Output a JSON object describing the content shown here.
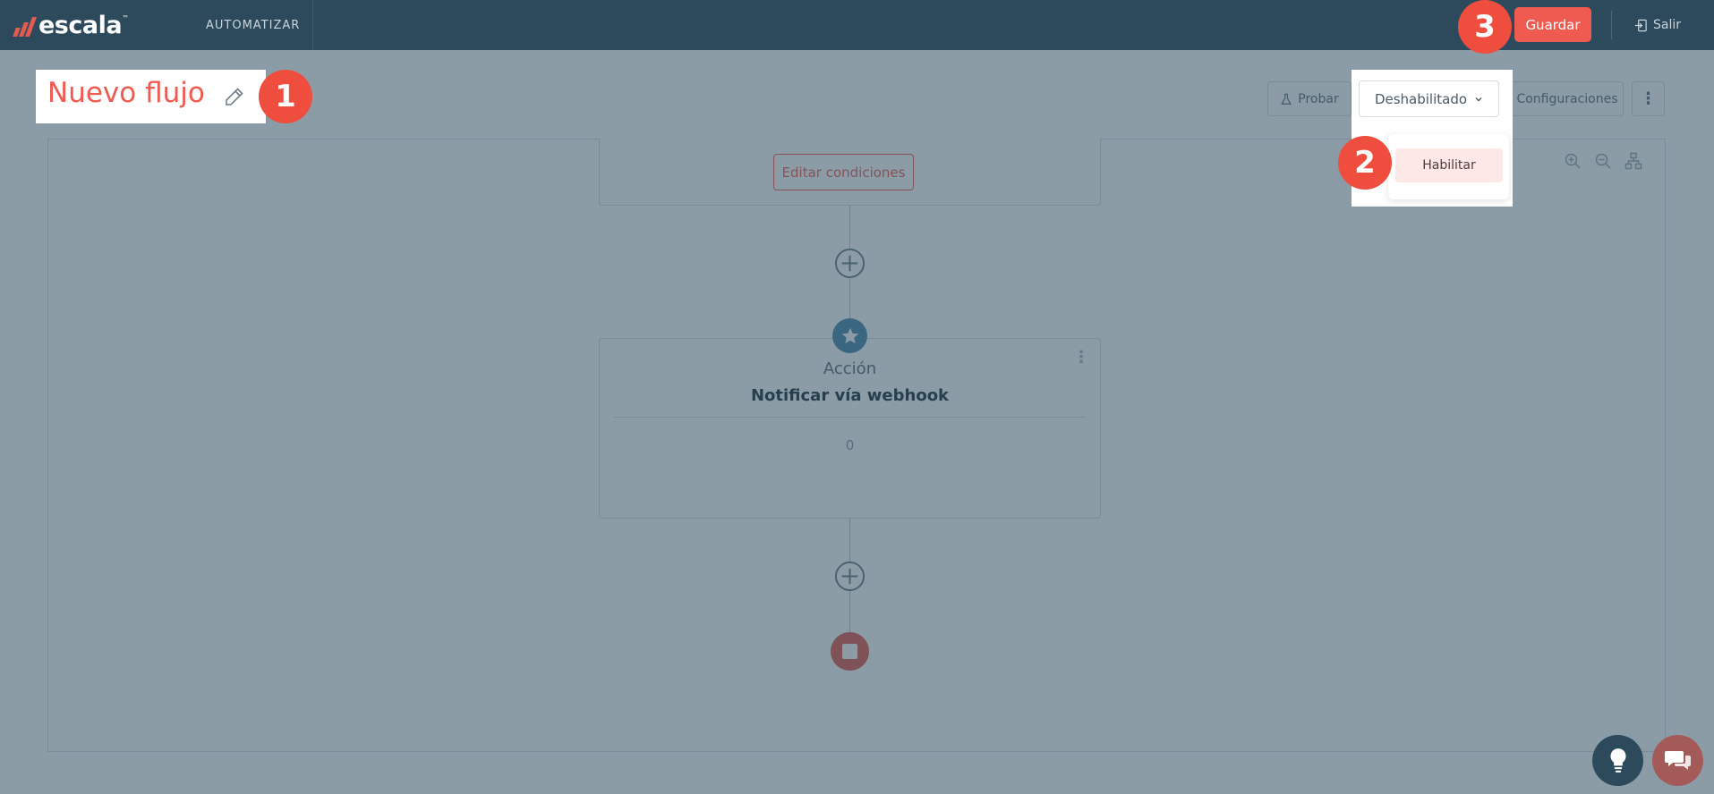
{
  "header": {
    "logo_text": "escala",
    "logo_tm": "™",
    "nav_item": "AUTOMATIZAR",
    "save_label": "Guardar",
    "logout_label": "Salir"
  },
  "flow": {
    "title": "Nuevo flujo"
  },
  "toolbar": {
    "probar_label": "Probar",
    "status_label": "Deshabilitado",
    "config_label": "Configuraciones",
    "more_label": "⋮"
  },
  "status_dropdown": {
    "items": [
      "Habilitar"
    ]
  },
  "canvas": {
    "edit_conditions_label": "Editar condiciones",
    "action": {
      "type": "Acción",
      "name": "Notificar vía webhook",
      "count": "0",
      "kebab": "⋮"
    }
  },
  "steps": [
    "1",
    "2",
    "3"
  ],
  "colors": {
    "topbar": "#2c4a5c",
    "accent": "#ef5b50",
    "step_badge": "#ef4d3d",
    "action_badge": "#4e88b0"
  },
  "icons": {
    "edit": "pencil-icon",
    "probar": "flask-icon",
    "status": "chevron-down-icon",
    "logout": "logout-icon",
    "zoom_in": "zoom-in-icon",
    "zoom_out": "zoom-out-icon",
    "layout": "hierarchy-icon",
    "add": "plus-circle-icon",
    "action": "star-icon",
    "end": "stop-icon",
    "help": "lightbulb-icon",
    "chat": "chat-icon"
  }
}
